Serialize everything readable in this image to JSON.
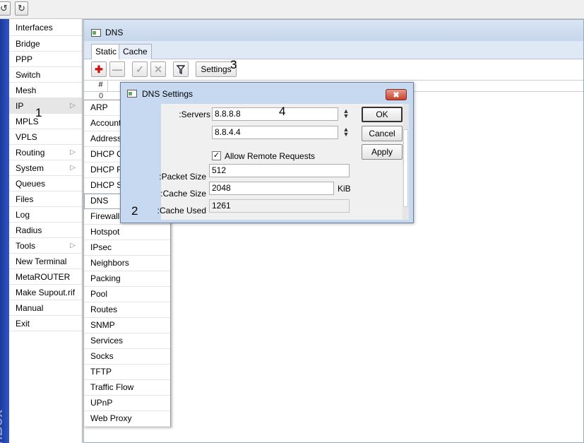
{
  "toolbar": {
    "undo_icon": "undo-icon",
    "redo_icon": "redo-icon"
  },
  "sidebar": {
    "logo_text": "WinBox",
    "items": [
      {
        "label": "Interfaces",
        "submenu": false
      },
      {
        "label": "Bridge",
        "submenu": false
      },
      {
        "label": "PPP",
        "submenu": false
      },
      {
        "label": "Switch",
        "submenu": false
      },
      {
        "label": "Mesh",
        "submenu": false
      },
      {
        "label": "IP",
        "submenu": true
      },
      {
        "label": "MPLS",
        "submenu": false
      },
      {
        "label": "VPLS",
        "submenu": false
      },
      {
        "label": "Routing",
        "submenu": true
      },
      {
        "label": "System",
        "submenu": true
      },
      {
        "label": "Queues",
        "submenu": false
      },
      {
        "label": "Files",
        "submenu": false
      },
      {
        "label": "Log",
        "submenu": false
      },
      {
        "label": "Radius",
        "submenu": false
      },
      {
        "label": "Tools",
        "submenu": true
      },
      {
        "label": "New Terminal",
        "submenu": false
      },
      {
        "label": "MetaROUTER",
        "submenu": false
      },
      {
        "label": "Make Supout.rif",
        "submenu": false
      },
      {
        "label": "Manual",
        "submenu": false
      },
      {
        "label": "Exit",
        "submenu": false
      }
    ]
  },
  "ip_submenu": {
    "items": [
      "ARP",
      "Accounting",
      "Addresses",
      "DHCP Client",
      "DHCP Relay",
      "DHCP Server",
      "DNS",
      "Firewall",
      "Hotspot",
      "IPsec",
      "Neighbors",
      "Packing",
      "Pool",
      "Routes",
      "SNMP",
      "Services",
      "Socks",
      "TFTP",
      "Traffic Flow",
      "UPnP",
      "Web Proxy"
    ],
    "selected": "DNS"
  },
  "dns_window": {
    "title": "DNS",
    "tabs": [
      "Static",
      "Cache"
    ],
    "active_tab": "Static",
    "settings_button": "Settings",
    "table_header": "#",
    "row_number": "0"
  },
  "dns_settings": {
    "title": "DNS Settings",
    "servers_label": "Servers:",
    "server_1": "8.8.8.8",
    "server_2": "8.8.4.4",
    "allow_remote_label": "Allow Remote Requests",
    "allow_remote_checked": true,
    "packet_size_label": "Packet Size:",
    "packet_size": "512",
    "cache_size_label": "Cache Size:",
    "cache_size": "2048",
    "cache_size_unit": "KiB",
    "cache_used_label": "Cache Used:",
    "cache_used": "1261",
    "ok_button": "OK",
    "cancel_button": "Cancel",
    "apply_button": "Apply"
  },
  "annotations": {
    "step1": "1",
    "step2": "2",
    "step3": "3",
    "step4": "4"
  },
  "colors": {
    "strip": "#2a4cb8",
    "title_bar": "#c6d9f0",
    "close_button": "#c8422e",
    "add_icon": "#cc1111"
  }
}
